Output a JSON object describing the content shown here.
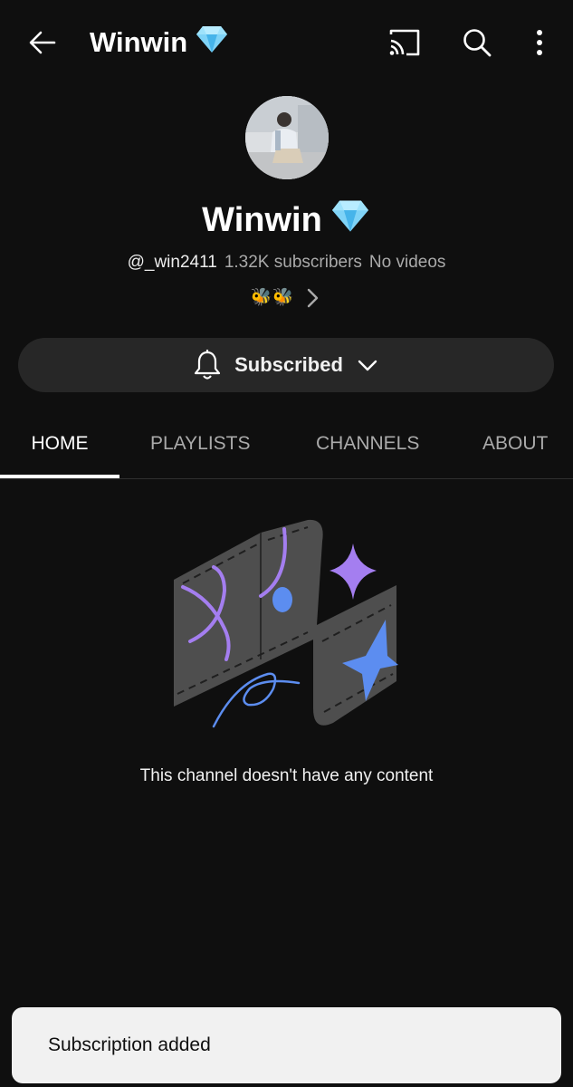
{
  "header": {
    "title": "Winwin",
    "title_emoji_icon": "gem-icon",
    "icons": [
      "back-arrow-icon",
      "cast-icon",
      "search-icon",
      "more-vert-icon"
    ]
  },
  "channel": {
    "name": "Winwin",
    "name_emoji_icon": "gem-icon",
    "handle": "@_win2411",
    "subscribers": "1.32K subscribers",
    "videos": "No videos",
    "links_text": "🐝🐝"
  },
  "subscribe_button": {
    "label": "Subscribed",
    "icons": [
      "bell-icon",
      "chevron-down-icon"
    ]
  },
  "tabs": [
    {
      "label": "HOME",
      "selected": true
    },
    {
      "label": "PLAYLISTS",
      "selected": false
    },
    {
      "label": "CHANNELS",
      "selected": false
    },
    {
      "label": "ABOUT",
      "selected": false
    }
  ],
  "empty_state": {
    "message": "This channel doesn't have any content"
  },
  "snackbar": {
    "message": "Subscription added"
  },
  "colors": {
    "background": "#0f0f0f",
    "button_bg": "#272727",
    "secondary_text": "#aaaaaa",
    "snackbar_bg": "#f1f1f1",
    "accent_purple": "#a47ef0",
    "accent_blue": "#5c8df0"
  }
}
